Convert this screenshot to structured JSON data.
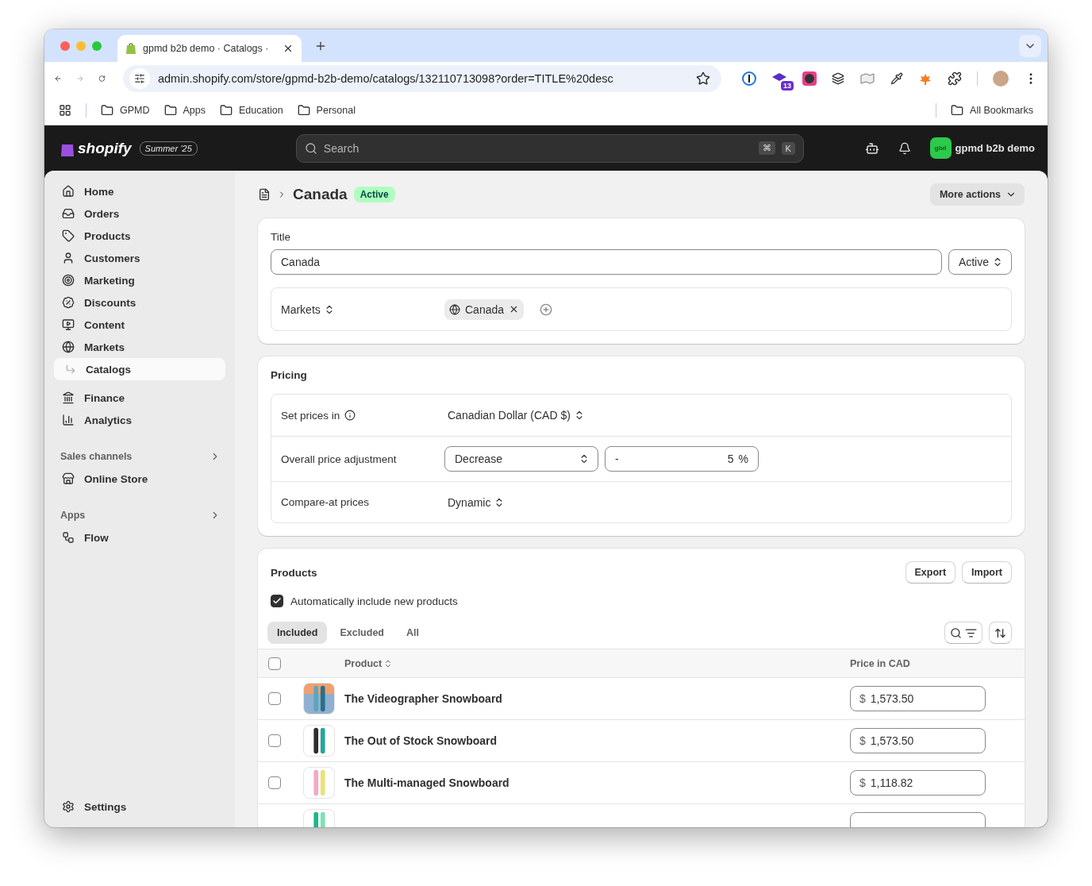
{
  "browser": {
    "tab_title": "gpmd b2b demo · Catalogs ·",
    "url": "admin.shopify.com/store/gpmd-b2b-demo/catalogs/132110713098?order=TITLE%20desc",
    "extension_badge": "13",
    "bookmarks": [
      "GPMD",
      "Apps",
      "Education",
      "Personal"
    ],
    "all_bookmarks": "All Bookmarks"
  },
  "header": {
    "logo": "shopify",
    "edition": "Summer ’25",
    "search_placeholder": "Search",
    "shortcut": [
      "⌘",
      "K"
    ],
    "store_initials": "gbd",
    "store_name": "gpmd b2b demo"
  },
  "sidebar": {
    "items": [
      {
        "label": "Home",
        "selected": false
      },
      {
        "label": "Orders",
        "selected": false
      },
      {
        "label": "Products",
        "selected": false
      },
      {
        "label": "Customers",
        "selected": false
      },
      {
        "label": "Marketing",
        "selected": false
      },
      {
        "label": "Discounts",
        "selected": false
      },
      {
        "label": "Content",
        "selected": false
      },
      {
        "label": "Markets",
        "selected": false,
        "children": [
          {
            "label": "Catalogs",
            "selected": true
          }
        ]
      },
      {
        "label": "Finance",
        "selected": false
      },
      {
        "label": "Analytics",
        "selected": false
      }
    ],
    "sections": [
      {
        "heading": "Sales channels",
        "items": [
          {
            "label": "Online Store",
            "selected": false
          }
        ]
      },
      {
        "heading": "Apps",
        "items": [
          {
            "label": "Flow",
            "selected": false
          }
        ]
      }
    ],
    "settings": "Settings"
  },
  "page": {
    "title": "Canada",
    "status": "Active",
    "more_actions": "More actions"
  },
  "title_card": {
    "label": "Title",
    "value": "Canada",
    "status_select": "Active",
    "markets_label": "Markets",
    "market_tag": "Canada"
  },
  "pricing": {
    "heading": "Pricing",
    "rows": [
      {
        "kind": "select",
        "label": "Set prices in",
        "info": true,
        "value": "Canadian Dollar (CAD $)"
      },
      {
        "kind": "adjustment",
        "label": "Overall price adjustment",
        "select": "Decrease",
        "sign": "-",
        "amount": "5",
        "unit": "%"
      },
      {
        "kind": "select",
        "label": "Compare-at prices",
        "info": false,
        "value": "Dynamic"
      }
    ]
  },
  "products": {
    "heading": "Products",
    "actions": [
      "Export",
      "Import"
    ],
    "auto_include": {
      "label": "Automatically include new products",
      "checked": true
    },
    "tabs": [
      {
        "label": "Included",
        "selected": true
      },
      {
        "label": "Excluded",
        "selected": false
      },
      {
        "label": "All",
        "selected": false
      }
    ],
    "columns": {
      "product": "Product",
      "price": "Price in CAD"
    },
    "select_all_checked": false,
    "rows": [
      {
        "name": "The Videographer Snowboard",
        "currency": "$",
        "price": "1,573.50",
        "selected": false
      },
      {
        "name": "The Out of Stock Snowboard",
        "currency": "$",
        "price": "1,573.50",
        "selected": false
      },
      {
        "name": "The Multi-managed Snowboard",
        "currency": "$",
        "price": "1,118.82",
        "selected": false
      }
    ]
  }
}
